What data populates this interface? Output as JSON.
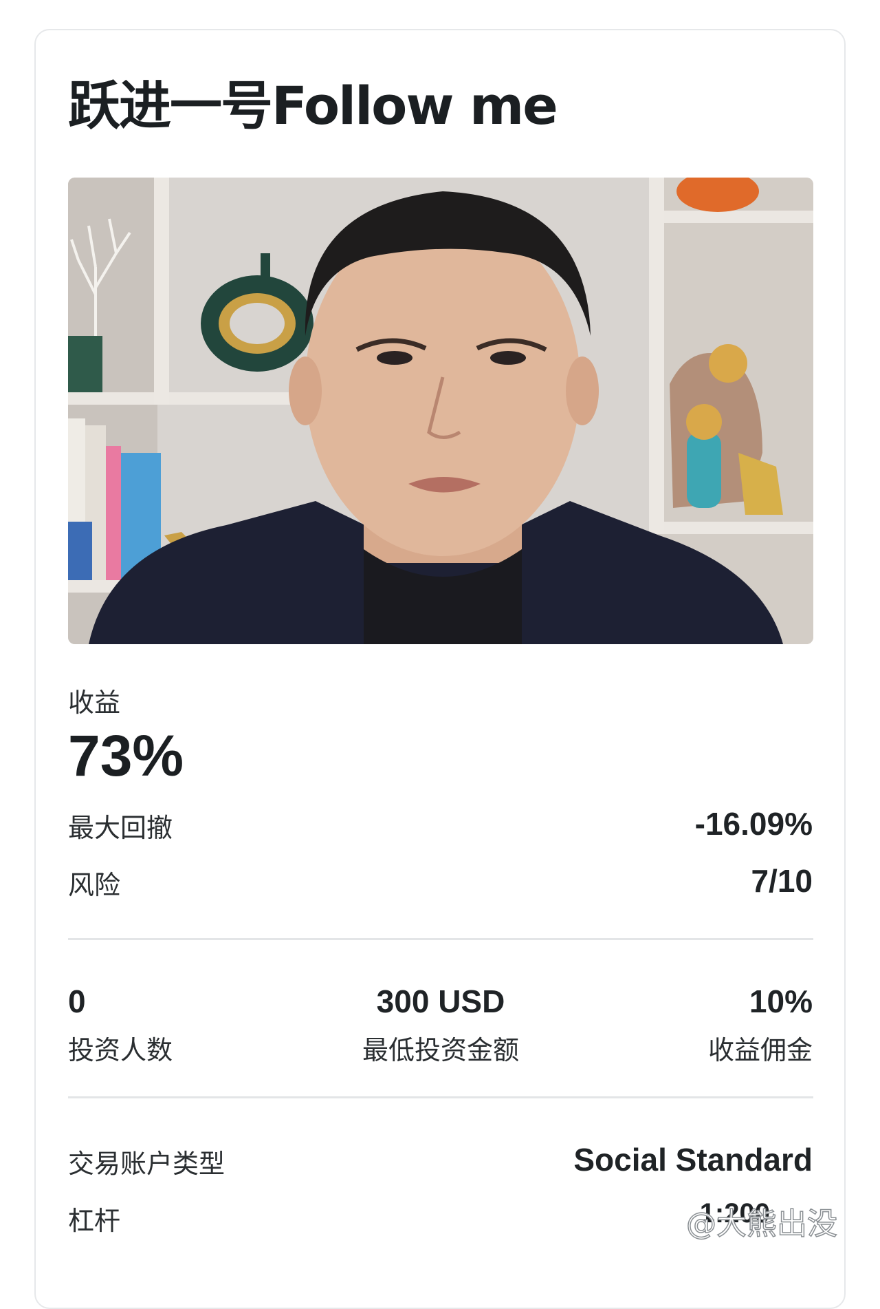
{
  "card": {
    "title": "跃进一号Follow me",
    "photo_alt": "portrait",
    "returns": {
      "label": "收益",
      "value": "73%"
    },
    "max_drawdown": {
      "label": "最大回撤",
      "value": "-16.09%"
    },
    "risk": {
      "label": "风险",
      "value": "7/10"
    },
    "stats": [
      {
        "value": "0",
        "label": "投资人数"
      },
      {
        "value": "300 USD",
        "label": "最低投资金额"
      },
      {
        "value": "10%",
        "label": "收益佣金"
      }
    ],
    "account_type": {
      "label": "交易账户类型",
      "value": "Social Standard"
    },
    "leverage": {
      "label": "杠杆",
      "value": "1:200"
    }
  },
  "watermark": "@大熊出没"
}
